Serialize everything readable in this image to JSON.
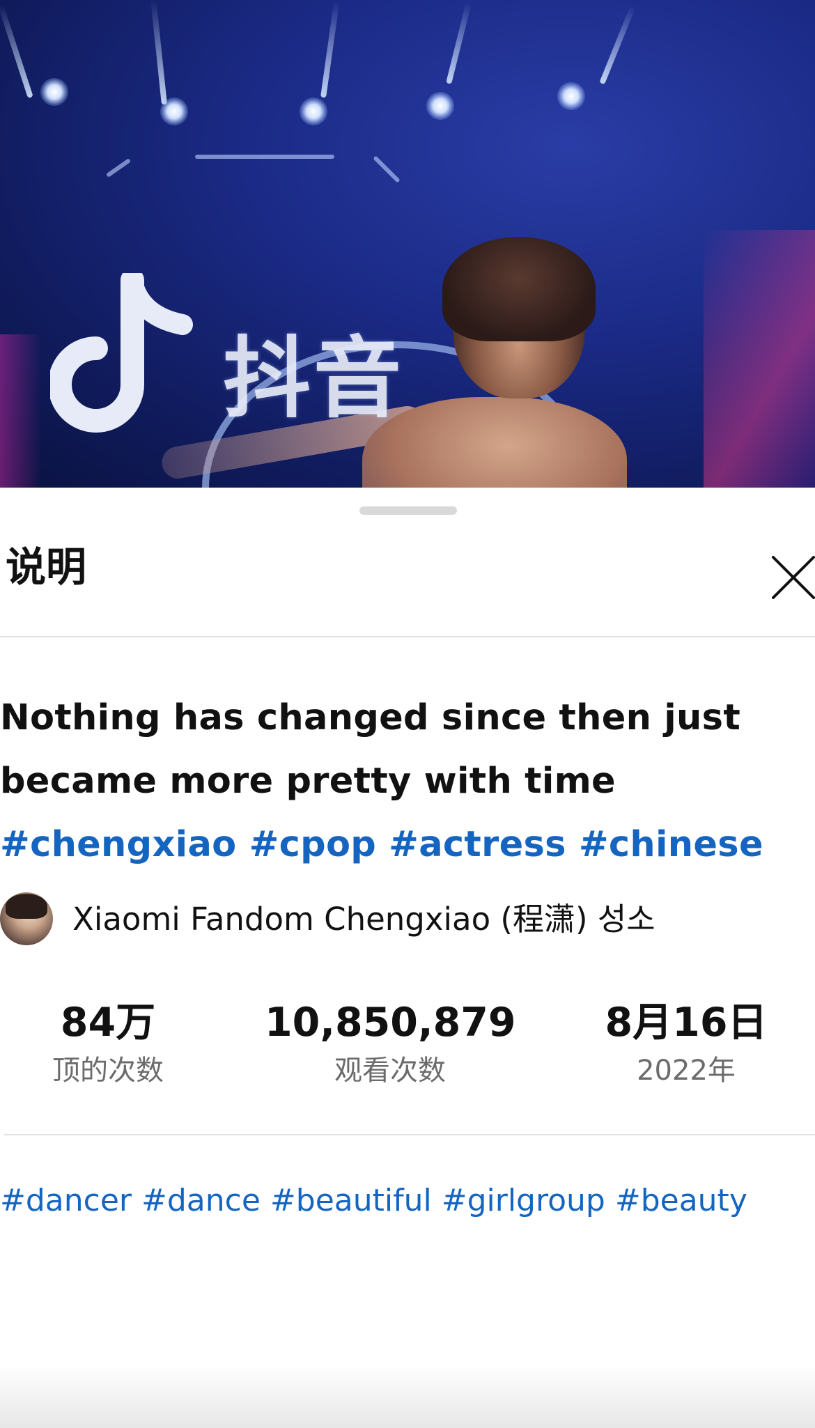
{
  "video": {
    "overlay_text": "抖音",
    "logo_icon": "tiktok-logo-icon",
    "background_color": "#1b2a86"
  },
  "sheet": {
    "title": "说明",
    "close_icon": "close-icon"
  },
  "caption": {
    "text": "Nothing has changed since then just became more pretty with time ",
    "hashtags": [
      "#chengxiao",
      "#cpop",
      "#actress",
      "#chinese"
    ],
    "hashtag_color": "#1565c0"
  },
  "author": {
    "name": "Xiaomi Fandom Chengxiao (程潇) 성소"
  },
  "stats": [
    {
      "value": "84万",
      "label": "顶的次数"
    },
    {
      "value": "10,850,879",
      "label": "观看次数"
    },
    {
      "value": "8月16日",
      "label": "2022年"
    }
  ],
  "tags": [
    "#dancer",
    "#dance",
    "#beautiful",
    "#girlgroup",
    "#beauty"
  ]
}
